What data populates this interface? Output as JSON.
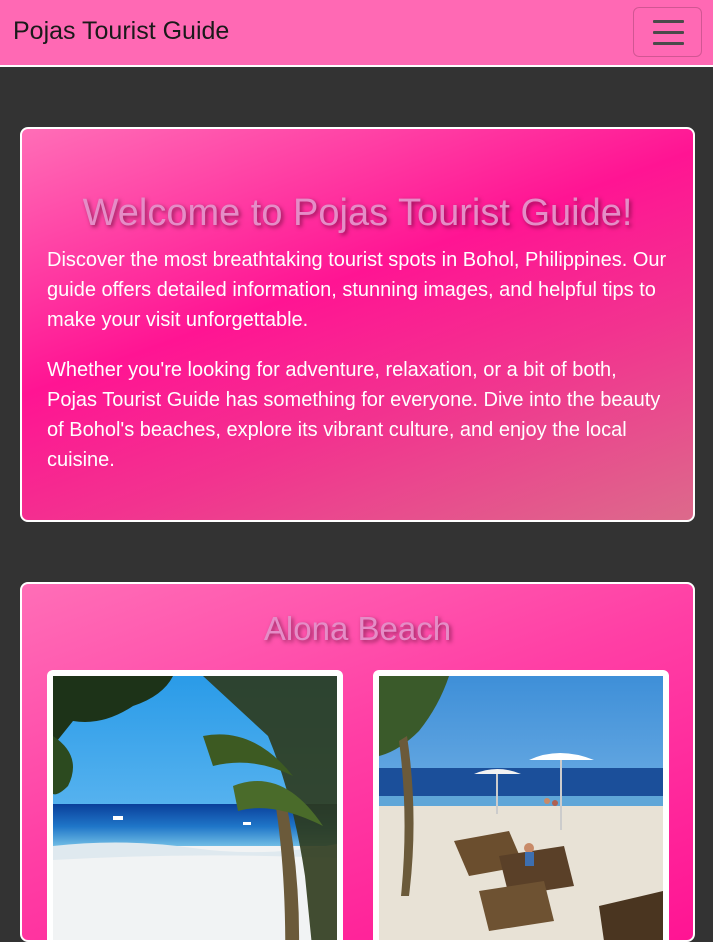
{
  "navbar": {
    "brand": "Pojas Tourist Guide",
    "toggler_icon": "hamburger-menu-icon",
    "background_color": "#ff69b4"
  },
  "hero": {
    "title": "Welcome to Pojas Tourist Guide!",
    "paragraphs": [
      "Discover the most breathtaking tourist spots in Bohol, Philippines. Our guide offers detailed information, stunning images, and helpful tips to make your visit unforgettable.",
      "Whether you're looking for adventure, relaxation, or a bit of both, Pojas Tourist Guide has something for everyone. Dive into the beauty of Bohol's beaches, explore its vibrant culture, and enjoy the local cuisine."
    ]
  },
  "destination": {
    "title": "Alona Beach",
    "images": [
      {
        "subject": "palm-trees-and-sea-photo"
      },
      {
        "subject": "beach-umbrellas-and-loungers-photo"
      }
    ]
  },
  "colors": {
    "page_background": "#333333",
    "accent_pink": "#ff1493",
    "heading_pink": "#e58dc7",
    "card_border": "#ffffff"
  }
}
